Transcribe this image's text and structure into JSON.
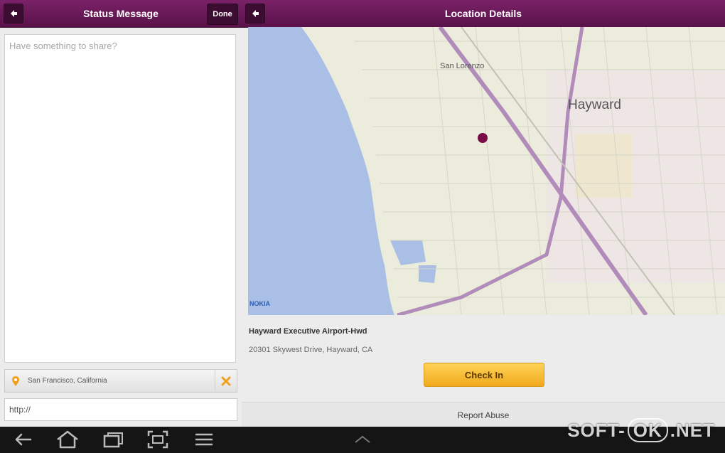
{
  "status_pane": {
    "title": "Status Message",
    "done_label": "Done",
    "status_placeholder": "Have something to share?",
    "location": "San Francisco, California",
    "url_value": "http://"
  },
  "location_pane": {
    "title": "Location Details",
    "place_name": "Hayward Executive Airport-Hwd",
    "address": "20301 Skywest Drive, Hayward, CA",
    "checkin_label": "Check In",
    "report_label": "Report Abuse"
  },
  "map": {
    "labels": {
      "hayward": "Hayward",
      "san_lorenzo": "San Lorenzo",
      "attribution": "NOKIA"
    },
    "colors": {
      "water": "#a9bfe6",
      "land": "#ececdc",
      "highway": "#b18cbb",
      "marker": "#7a0c4a"
    }
  },
  "system_bar": {
    "icons": [
      "back-icon",
      "home-icon",
      "recent-apps-icon",
      "screenshot-icon",
      "menu-icon",
      "chevron-up-icon"
    ]
  },
  "watermark": {
    "left": "SOFT-",
    "ok": "OK",
    "right": ".NET"
  }
}
